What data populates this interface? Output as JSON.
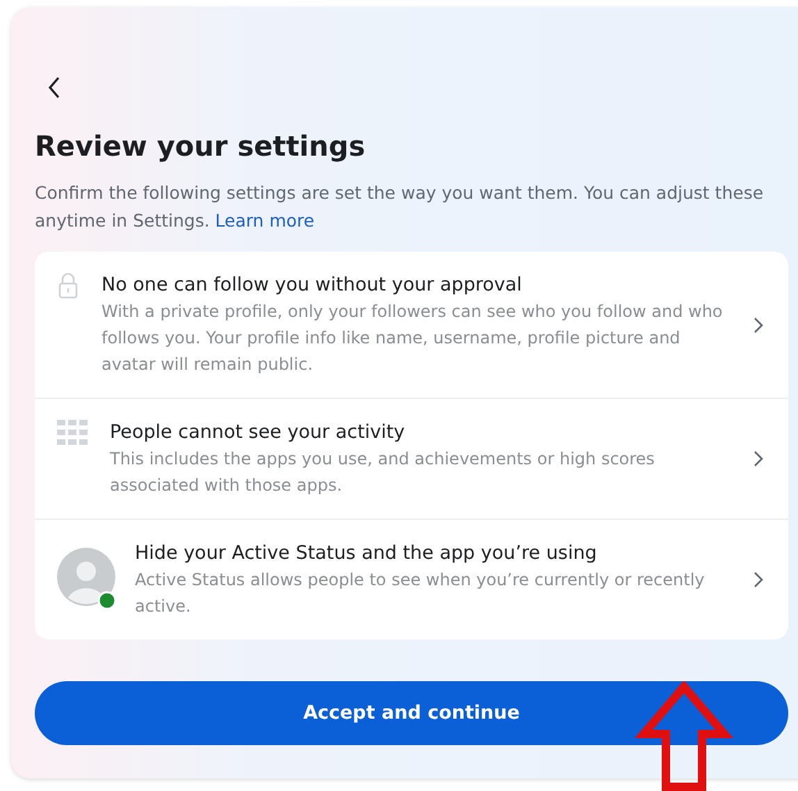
{
  "title": "Review your settings",
  "description": "Confirm the following settings are set the way you want them. You can adjust these anytime in Settings.",
  "learn_more": "Learn more",
  "settings": [
    {
      "kind": "lock",
      "title": "No one can follow you without your approval",
      "detail": "With a private profile, only your followers can see who you follow and who follows you. Your profile info like name, username, profile picture and avatar will remain public."
    },
    {
      "kind": "grid",
      "title": "People cannot see your activity",
      "detail": "This includes the apps you use, and achievements or high scores associated with those apps."
    },
    {
      "kind": "avatar",
      "title": "Hide your Active Status and the app you’re using",
      "detail": "Active Status allows people to see when you’re currently or recently active."
    }
  ],
  "button": "Accept and continue"
}
